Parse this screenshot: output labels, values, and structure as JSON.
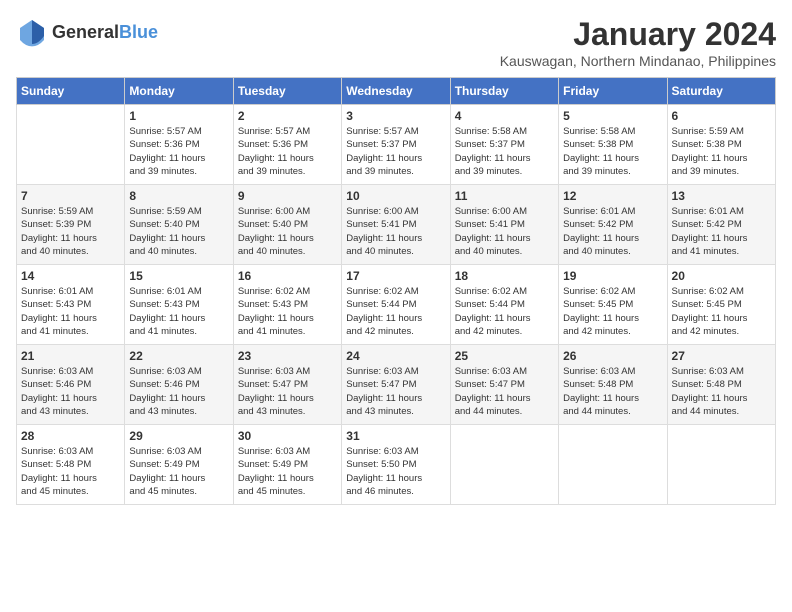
{
  "header": {
    "logo_general": "General",
    "logo_blue": "Blue",
    "month": "January 2024",
    "location": "Kauswagan, Northern Mindanao, Philippines"
  },
  "weekdays": [
    "Sunday",
    "Monday",
    "Tuesday",
    "Wednesday",
    "Thursday",
    "Friday",
    "Saturday"
  ],
  "weeks": [
    [
      {
        "day": "",
        "info": ""
      },
      {
        "day": "1",
        "info": "Sunrise: 5:57 AM\nSunset: 5:36 PM\nDaylight: 11 hours\nand 39 minutes."
      },
      {
        "day": "2",
        "info": "Sunrise: 5:57 AM\nSunset: 5:36 PM\nDaylight: 11 hours\nand 39 minutes."
      },
      {
        "day": "3",
        "info": "Sunrise: 5:57 AM\nSunset: 5:37 PM\nDaylight: 11 hours\nand 39 minutes."
      },
      {
        "day": "4",
        "info": "Sunrise: 5:58 AM\nSunset: 5:37 PM\nDaylight: 11 hours\nand 39 minutes."
      },
      {
        "day": "5",
        "info": "Sunrise: 5:58 AM\nSunset: 5:38 PM\nDaylight: 11 hours\nand 39 minutes."
      },
      {
        "day": "6",
        "info": "Sunrise: 5:59 AM\nSunset: 5:38 PM\nDaylight: 11 hours\nand 39 minutes."
      }
    ],
    [
      {
        "day": "7",
        "info": "Sunrise: 5:59 AM\nSunset: 5:39 PM\nDaylight: 11 hours\nand 40 minutes."
      },
      {
        "day": "8",
        "info": "Sunrise: 5:59 AM\nSunset: 5:40 PM\nDaylight: 11 hours\nand 40 minutes."
      },
      {
        "day": "9",
        "info": "Sunrise: 6:00 AM\nSunset: 5:40 PM\nDaylight: 11 hours\nand 40 minutes."
      },
      {
        "day": "10",
        "info": "Sunrise: 6:00 AM\nSunset: 5:41 PM\nDaylight: 11 hours\nand 40 minutes."
      },
      {
        "day": "11",
        "info": "Sunrise: 6:00 AM\nSunset: 5:41 PM\nDaylight: 11 hours\nand 40 minutes."
      },
      {
        "day": "12",
        "info": "Sunrise: 6:01 AM\nSunset: 5:42 PM\nDaylight: 11 hours\nand 40 minutes."
      },
      {
        "day": "13",
        "info": "Sunrise: 6:01 AM\nSunset: 5:42 PM\nDaylight: 11 hours\nand 41 minutes."
      }
    ],
    [
      {
        "day": "14",
        "info": "Sunrise: 6:01 AM\nSunset: 5:43 PM\nDaylight: 11 hours\nand 41 minutes."
      },
      {
        "day": "15",
        "info": "Sunrise: 6:01 AM\nSunset: 5:43 PM\nDaylight: 11 hours\nand 41 minutes."
      },
      {
        "day": "16",
        "info": "Sunrise: 6:02 AM\nSunset: 5:43 PM\nDaylight: 11 hours\nand 41 minutes."
      },
      {
        "day": "17",
        "info": "Sunrise: 6:02 AM\nSunset: 5:44 PM\nDaylight: 11 hours\nand 42 minutes."
      },
      {
        "day": "18",
        "info": "Sunrise: 6:02 AM\nSunset: 5:44 PM\nDaylight: 11 hours\nand 42 minutes."
      },
      {
        "day": "19",
        "info": "Sunrise: 6:02 AM\nSunset: 5:45 PM\nDaylight: 11 hours\nand 42 minutes."
      },
      {
        "day": "20",
        "info": "Sunrise: 6:02 AM\nSunset: 5:45 PM\nDaylight: 11 hours\nand 42 minutes."
      }
    ],
    [
      {
        "day": "21",
        "info": "Sunrise: 6:03 AM\nSunset: 5:46 PM\nDaylight: 11 hours\nand 43 minutes."
      },
      {
        "day": "22",
        "info": "Sunrise: 6:03 AM\nSunset: 5:46 PM\nDaylight: 11 hours\nand 43 minutes."
      },
      {
        "day": "23",
        "info": "Sunrise: 6:03 AM\nSunset: 5:47 PM\nDaylight: 11 hours\nand 43 minutes."
      },
      {
        "day": "24",
        "info": "Sunrise: 6:03 AM\nSunset: 5:47 PM\nDaylight: 11 hours\nand 43 minutes."
      },
      {
        "day": "25",
        "info": "Sunrise: 6:03 AM\nSunset: 5:47 PM\nDaylight: 11 hours\nand 44 minutes."
      },
      {
        "day": "26",
        "info": "Sunrise: 6:03 AM\nSunset: 5:48 PM\nDaylight: 11 hours\nand 44 minutes."
      },
      {
        "day": "27",
        "info": "Sunrise: 6:03 AM\nSunset: 5:48 PM\nDaylight: 11 hours\nand 44 minutes."
      }
    ],
    [
      {
        "day": "28",
        "info": "Sunrise: 6:03 AM\nSunset: 5:48 PM\nDaylight: 11 hours\nand 45 minutes."
      },
      {
        "day": "29",
        "info": "Sunrise: 6:03 AM\nSunset: 5:49 PM\nDaylight: 11 hours\nand 45 minutes."
      },
      {
        "day": "30",
        "info": "Sunrise: 6:03 AM\nSunset: 5:49 PM\nDaylight: 11 hours\nand 45 minutes."
      },
      {
        "day": "31",
        "info": "Sunrise: 6:03 AM\nSunset: 5:50 PM\nDaylight: 11 hours\nand 46 minutes."
      },
      {
        "day": "",
        "info": ""
      },
      {
        "day": "",
        "info": ""
      },
      {
        "day": "",
        "info": ""
      }
    ]
  ]
}
